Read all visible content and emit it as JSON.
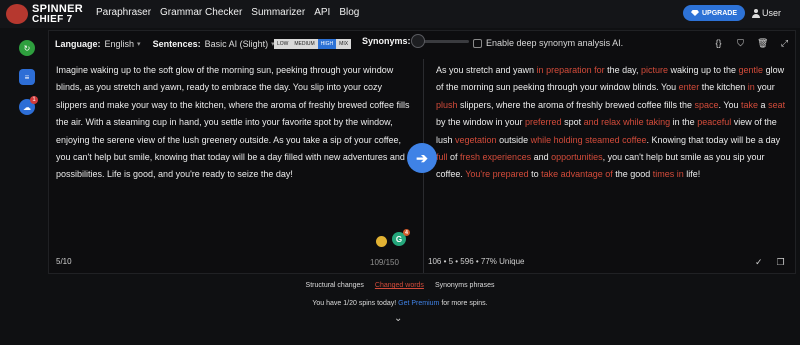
{
  "logo": {
    "line1": "SPINNER",
    "line2": "CHIEF 7"
  },
  "nav": [
    "Paraphraser",
    "Grammar Checker",
    "Summarizer",
    "API",
    "Blog"
  ],
  "header": {
    "upgrade_label": "UPGRADE",
    "user_label": "User"
  },
  "rail": {
    "notification_count": "1"
  },
  "toolbar": {
    "language_label": "Language:",
    "language_value": "English",
    "sentences_label": "Sentences:",
    "sentences_value": "Basic AI (Slight)",
    "modes": [
      "LOW",
      "MEDIUM",
      "HIGH",
      "MIX"
    ],
    "active_mode": "HIGH",
    "synonyms_label": "Synonyms:",
    "synonyms_level": 0,
    "deep_label": "Enable deep synonym analysis AI.",
    "deep_checked": false
  },
  "input_text": "Imagine waking up to the soft glow of the morning sun, peeking through your window blinds, as you stretch and yawn, ready to embrace the day. You slip into your cozy slippers and make your way to the kitchen, where the aroma of freshly brewed coffee fills the air. With a steaming cup in hand, you settle into your favorite spot by the window, enjoying the serene view of the lush greenery outside. As you take a sip of your coffee, you can't help but smile, knowing that today will be a day filled with new adventures and possibilities. Life is good, and you're ready to seize the day!",
  "output_segments": [
    {
      "t": "As you stretch and yawn ",
      "c": false
    },
    {
      "t": "in preparation for",
      "c": true
    },
    {
      "t": " the day, ",
      "c": false
    },
    {
      "t": "picture",
      "c": true
    },
    {
      "t": " waking up to the ",
      "c": false
    },
    {
      "t": "gentle",
      "c": true
    },
    {
      "t": " glow of the morning sun peeking through your window blinds. You ",
      "c": false
    },
    {
      "t": "enter",
      "c": true
    },
    {
      "t": " the kitchen ",
      "c": false
    },
    {
      "t": "in",
      "c": true
    },
    {
      "t": " your ",
      "c": false
    },
    {
      "t": "plush",
      "c": true
    },
    {
      "t": " slippers, where the aroma of freshly brewed coffee fills the ",
      "c": false
    },
    {
      "t": "space",
      "c": true
    },
    {
      "t": ". You ",
      "c": false
    },
    {
      "t": "take",
      "c": true
    },
    {
      "t": " a ",
      "c": false
    },
    {
      "t": "seat",
      "c": true
    },
    {
      "t": " by the window in your ",
      "c": false
    },
    {
      "t": "preferred",
      "c": true
    },
    {
      "t": " spot ",
      "c": false
    },
    {
      "t": "and relax while taking",
      "c": true
    },
    {
      "t": " in the ",
      "c": false
    },
    {
      "t": "peaceful",
      "c": true
    },
    {
      "t": " view of the lush ",
      "c": false
    },
    {
      "t": "vegetation",
      "c": true
    },
    {
      "t": " outside ",
      "c": false
    },
    {
      "t": "while holding steamed coffee",
      "c": true
    },
    {
      "t": ". Knowing that today will be a day ",
      "c": false
    },
    {
      "t": "full",
      "c": true
    },
    {
      "t": " of ",
      "c": false
    },
    {
      "t": "fresh experiences",
      "c": true
    },
    {
      "t": " and ",
      "c": false
    },
    {
      "t": "opportunities",
      "c": true
    },
    {
      "t": ", you can't help but smile as you sip your coffee. ",
      "c": false
    },
    {
      "t": "You're prepared",
      "c": true
    },
    {
      "t": " to ",
      "c": false
    },
    {
      "t": "take advantage of",
      "c": true
    },
    {
      "t": " the good ",
      "c": false
    },
    {
      "t": "times in",
      "c": true
    },
    {
      "t": " life!",
      "c": false
    }
  ],
  "input_footer": {
    "sentence_count": "5/10",
    "word_count": "109/150"
  },
  "output_footer": {
    "stats": "106  •  5  •  596  •  77% Unique"
  },
  "bottom_tabs": [
    "Structural changes",
    "Changed words",
    "Synonyms phrases"
  ],
  "active_bottom_tab": "Changed words",
  "spins": {
    "prefix": "You have 1/20 spins today!",
    "link": "Get Premium",
    "suffix": " for more spins."
  },
  "colors": {
    "accent": "#2d72d6",
    "changed_word": "#d24b3a",
    "background": "#0f1012"
  }
}
